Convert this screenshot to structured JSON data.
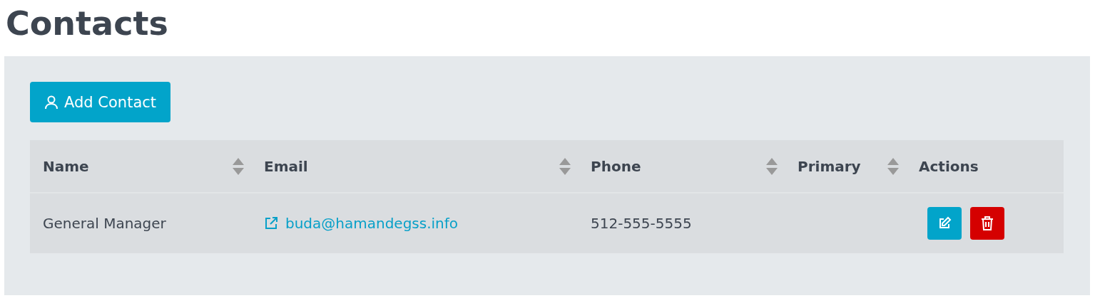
{
  "page": {
    "title": "Contacts"
  },
  "add_button": {
    "label": "Add Contact"
  },
  "table": {
    "columns": [
      {
        "label": "Name",
        "sortable": true
      },
      {
        "label": "Email",
        "sortable": true
      },
      {
        "label": "Phone",
        "sortable": true
      },
      {
        "label": "Primary",
        "sortable": true
      },
      {
        "label": "Actions",
        "sortable": false
      }
    ],
    "rows": [
      {
        "name": "General Manager",
        "email": "buda@hamandegss.info",
        "phone": "512-555-5555"
      }
    ]
  }
}
